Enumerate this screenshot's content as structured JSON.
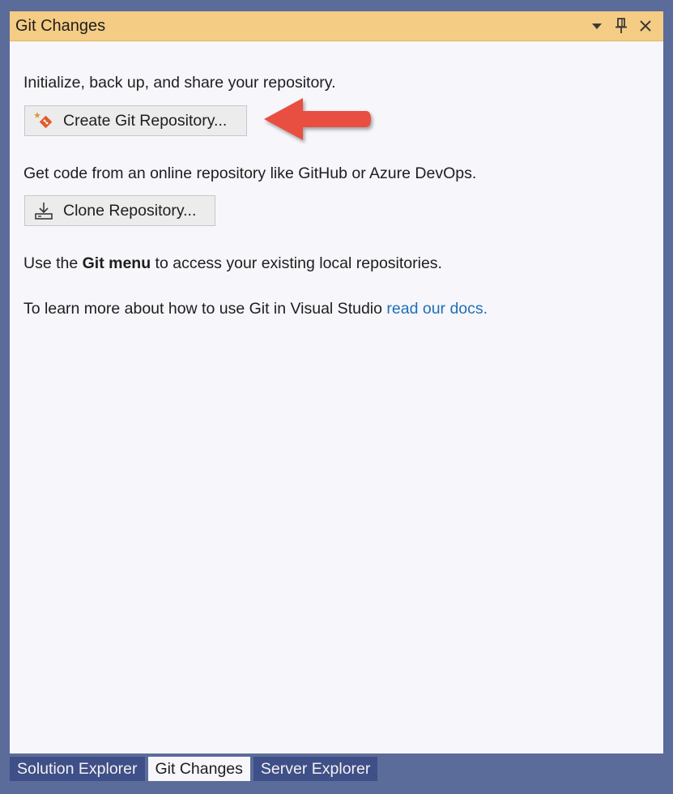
{
  "panel": {
    "title": "Git Changes"
  },
  "titlebar_icons": [
    "dropdown-arrow-icon",
    "pin-icon",
    "close-icon"
  ],
  "content": {
    "init_text": "Initialize, back up, and share your repository.",
    "create_button_label": "Create Git Repository...",
    "clone_text": "Get code from an online repository like GitHub or Azure DevOps.",
    "clone_button_label": "Clone Repository...",
    "git_menu_prefix": "Use the ",
    "git_menu_bold": "Git menu",
    "git_menu_suffix": " to access your existing local repositories.",
    "docs_prefix": "To learn more about how to use Git in Visual Studio ",
    "docs_link": "read our docs."
  },
  "tabs": [
    {
      "label": "Solution Explorer",
      "active": false
    },
    {
      "label": "Git Changes",
      "active": true
    },
    {
      "label": "Server Explorer",
      "active": false
    }
  ],
  "colors": {
    "titlebar": "#f5cc84",
    "background": "#5b6b9a",
    "link": "#1f6fb8",
    "annotation_arrow": "#e8503f"
  }
}
